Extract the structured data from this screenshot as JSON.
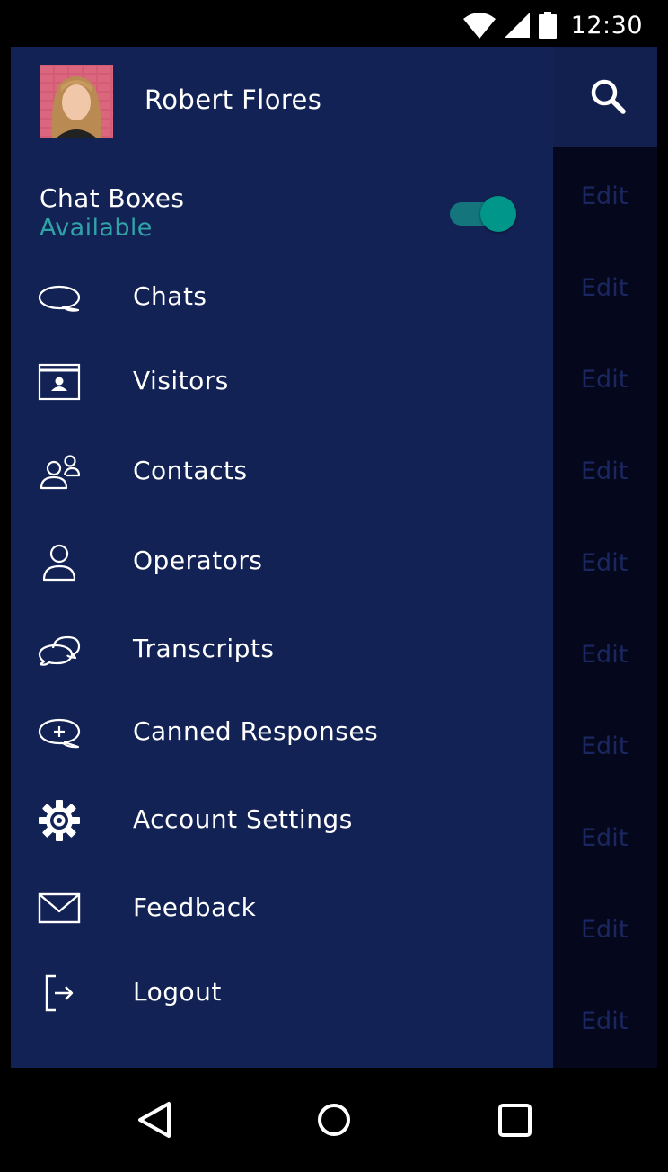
{
  "status_bar": {
    "time": "12:30",
    "icons": [
      "wifi-icon",
      "signal-icon",
      "battery-icon"
    ]
  },
  "background": {
    "toolbar_icon": "search-icon",
    "edit_links": [
      "Edit",
      "Edit",
      "Edit",
      "Edit",
      "Edit",
      "Edit",
      "Edit",
      "Edit",
      "Edit",
      "Edit"
    ]
  },
  "drawer": {
    "profile": {
      "name": "Robert Flores"
    },
    "status": {
      "title": "Chat Boxes",
      "value": "Available",
      "toggle_on": true
    },
    "menu": [
      {
        "label": "Chats",
        "icon": "chat-bubble-icon"
      },
      {
        "label": "Visitors",
        "icon": "visitor-card-icon"
      },
      {
        "label": "Contacts",
        "icon": "contacts-icon"
      },
      {
        "label": "Operators",
        "icon": "person-icon"
      },
      {
        "label": "Transcripts",
        "icon": "transcripts-icon"
      },
      {
        "label": "Canned Responses",
        "icon": "canned-response-icon"
      },
      {
        "label": "Account Settings",
        "icon": "gear-icon"
      },
      {
        "label": "Feedback",
        "icon": "envelope-icon"
      },
      {
        "label": "Logout",
        "icon": "logout-icon"
      }
    ]
  },
  "nav_bar": {
    "buttons": [
      "back-icon",
      "home-icon",
      "recents-icon"
    ]
  },
  "colors": {
    "drawer_bg": "#132255",
    "toolbar_bg": "#12204f",
    "accent_teal": "#00968a",
    "available_text": "#2fa3a6",
    "dim_edit_text": "#1a2760"
  }
}
